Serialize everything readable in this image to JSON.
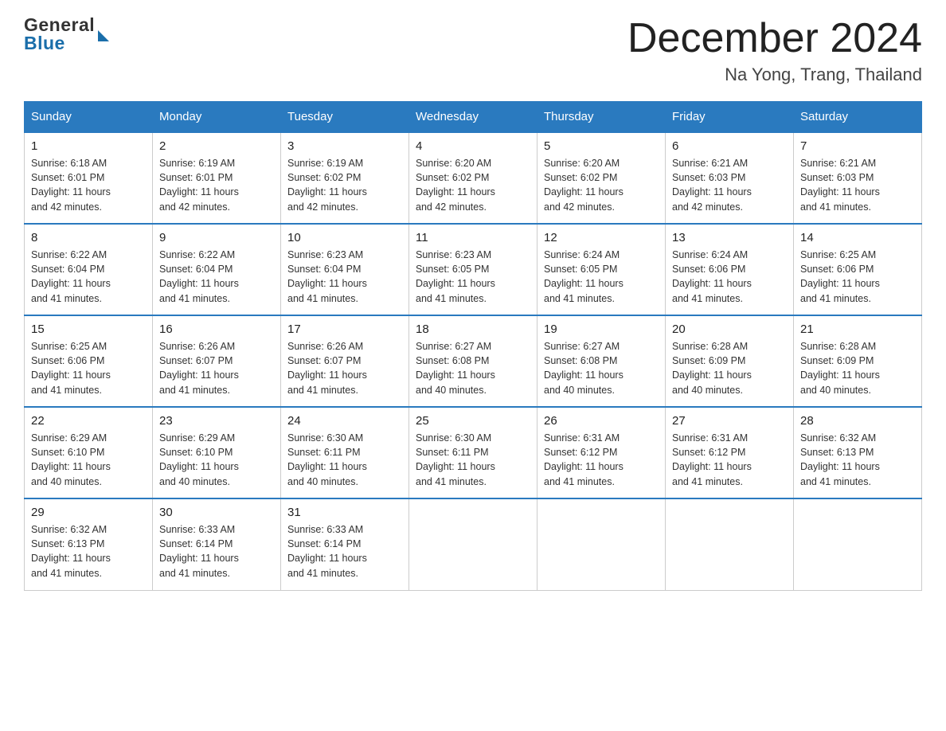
{
  "logo": {
    "general": "General",
    "blue": "Blue"
  },
  "header": {
    "month": "December 2024",
    "location": "Na Yong, Trang, Thailand"
  },
  "days": {
    "headers": [
      "Sunday",
      "Monday",
      "Tuesday",
      "Wednesday",
      "Thursday",
      "Friday",
      "Saturday"
    ]
  },
  "weeks": [
    [
      {
        "num": "1",
        "info": "Sunrise: 6:18 AM\nSunset: 6:01 PM\nDaylight: 11 hours\nand 42 minutes."
      },
      {
        "num": "2",
        "info": "Sunrise: 6:19 AM\nSunset: 6:01 PM\nDaylight: 11 hours\nand 42 minutes."
      },
      {
        "num": "3",
        "info": "Sunrise: 6:19 AM\nSunset: 6:02 PM\nDaylight: 11 hours\nand 42 minutes."
      },
      {
        "num": "4",
        "info": "Sunrise: 6:20 AM\nSunset: 6:02 PM\nDaylight: 11 hours\nand 42 minutes."
      },
      {
        "num": "5",
        "info": "Sunrise: 6:20 AM\nSunset: 6:02 PM\nDaylight: 11 hours\nand 42 minutes."
      },
      {
        "num": "6",
        "info": "Sunrise: 6:21 AM\nSunset: 6:03 PM\nDaylight: 11 hours\nand 42 minutes."
      },
      {
        "num": "7",
        "info": "Sunrise: 6:21 AM\nSunset: 6:03 PM\nDaylight: 11 hours\nand 41 minutes."
      }
    ],
    [
      {
        "num": "8",
        "info": "Sunrise: 6:22 AM\nSunset: 6:04 PM\nDaylight: 11 hours\nand 41 minutes."
      },
      {
        "num": "9",
        "info": "Sunrise: 6:22 AM\nSunset: 6:04 PM\nDaylight: 11 hours\nand 41 minutes."
      },
      {
        "num": "10",
        "info": "Sunrise: 6:23 AM\nSunset: 6:04 PM\nDaylight: 11 hours\nand 41 minutes."
      },
      {
        "num": "11",
        "info": "Sunrise: 6:23 AM\nSunset: 6:05 PM\nDaylight: 11 hours\nand 41 minutes."
      },
      {
        "num": "12",
        "info": "Sunrise: 6:24 AM\nSunset: 6:05 PM\nDaylight: 11 hours\nand 41 minutes."
      },
      {
        "num": "13",
        "info": "Sunrise: 6:24 AM\nSunset: 6:06 PM\nDaylight: 11 hours\nand 41 minutes."
      },
      {
        "num": "14",
        "info": "Sunrise: 6:25 AM\nSunset: 6:06 PM\nDaylight: 11 hours\nand 41 minutes."
      }
    ],
    [
      {
        "num": "15",
        "info": "Sunrise: 6:25 AM\nSunset: 6:06 PM\nDaylight: 11 hours\nand 41 minutes."
      },
      {
        "num": "16",
        "info": "Sunrise: 6:26 AM\nSunset: 6:07 PM\nDaylight: 11 hours\nand 41 minutes."
      },
      {
        "num": "17",
        "info": "Sunrise: 6:26 AM\nSunset: 6:07 PM\nDaylight: 11 hours\nand 41 minutes."
      },
      {
        "num": "18",
        "info": "Sunrise: 6:27 AM\nSunset: 6:08 PM\nDaylight: 11 hours\nand 40 minutes."
      },
      {
        "num": "19",
        "info": "Sunrise: 6:27 AM\nSunset: 6:08 PM\nDaylight: 11 hours\nand 40 minutes."
      },
      {
        "num": "20",
        "info": "Sunrise: 6:28 AM\nSunset: 6:09 PM\nDaylight: 11 hours\nand 40 minutes."
      },
      {
        "num": "21",
        "info": "Sunrise: 6:28 AM\nSunset: 6:09 PM\nDaylight: 11 hours\nand 40 minutes."
      }
    ],
    [
      {
        "num": "22",
        "info": "Sunrise: 6:29 AM\nSunset: 6:10 PM\nDaylight: 11 hours\nand 40 minutes."
      },
      {
        "num": "23",
        "info": "Sunrise: 6:29 AM\nSunset: 6:10 PM\nDaylight: 11 hours\nand 40 minutes."
      },
      {
        "num": "24",
        "info": "Sunrise: 6:30 AM\nSunset: 6:11 PM\nDaylight: 11 hours\nand 40 minutes."
      },
      {
        "num": "25",
        "info": "Sunrise: 6:30 AM\nSunset: 6:11 PM\nDaylight: 11 hours\nand 41 minutes."
      },
      {
        "num": "26",
        "info": "Sunrise: 6:31 AM\nSunset: 6:12 PM\nDaylight: 11 hours\nand 41 minutes."
      },
      {
        "num": "27",
        "info": "Sunrise: 6:31 AM\nSunset: 6:12 PM\nDaylight: 11 hours\nand 41 minutes."
      },
      {
        "num": "28",
        "info": "Sunrise: 6:32 AM\nSunset: 6:13 PM\nDaylight: 11 hours\nand 41 minutes."
      }
    ],
    [
      {
        "num": "29",
        "info": "Sunrise: 6:32 AM\nSunset: 6:13 PM\nDaylight: 11 hours\nand 41 minutes."
      },
      {
        "num": "30",
        "info": "Sunrise: 6:33 AM\nSunset: 6:14 PM\nDaylight: 11 hours\nand 41 minutes."
      },
      {
        "num": "31",
        "info": "Sunrise: 6:33 AM\nSunset: 6:14 PM\nDaylight: 11 hours\nand 41 minutes."
      },
      null,
      null,
      null,
      null
    ]
  ]
}
